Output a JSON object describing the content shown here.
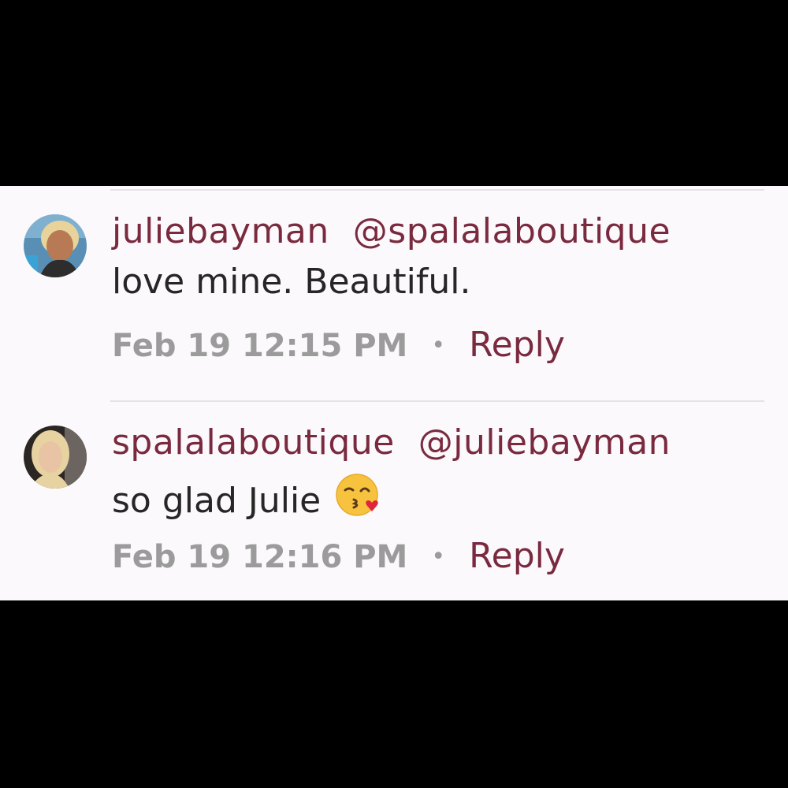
{
  "colors": {
    "background": "#fbf9fb",
    "username": "#7a2a3f",
    "text": "#262626",
    "meta": "#9b9b9b",
    "divider": "#e6e3e6",
    "letterbox": "#000000"
  },
  "comments": [
    {
      "avatar_icon": "profile-photo-icon",
      "username": "juliebayman",
      "mention": "@spalalaboutique",
      "text": "love mine. Beautiful.",
      "emoji": "",
      "timestamp": "Feb 19 12:15 PM",
      "separator": "•",
      "reply_label": "Reply"
    },
    {
      "avatar_icon": "profile-photo-icon",
      "username": "spalalaboutique",
      "mention": "@juliebayman",
      "text": "so glad Julie",
      "emoji": "kissing-heart-emoji-icon",
      "timestamp": "Feb 19 12:16 PM",
      "separator": "•",
      "reply_label": "Reply"
    }
  ]
}
